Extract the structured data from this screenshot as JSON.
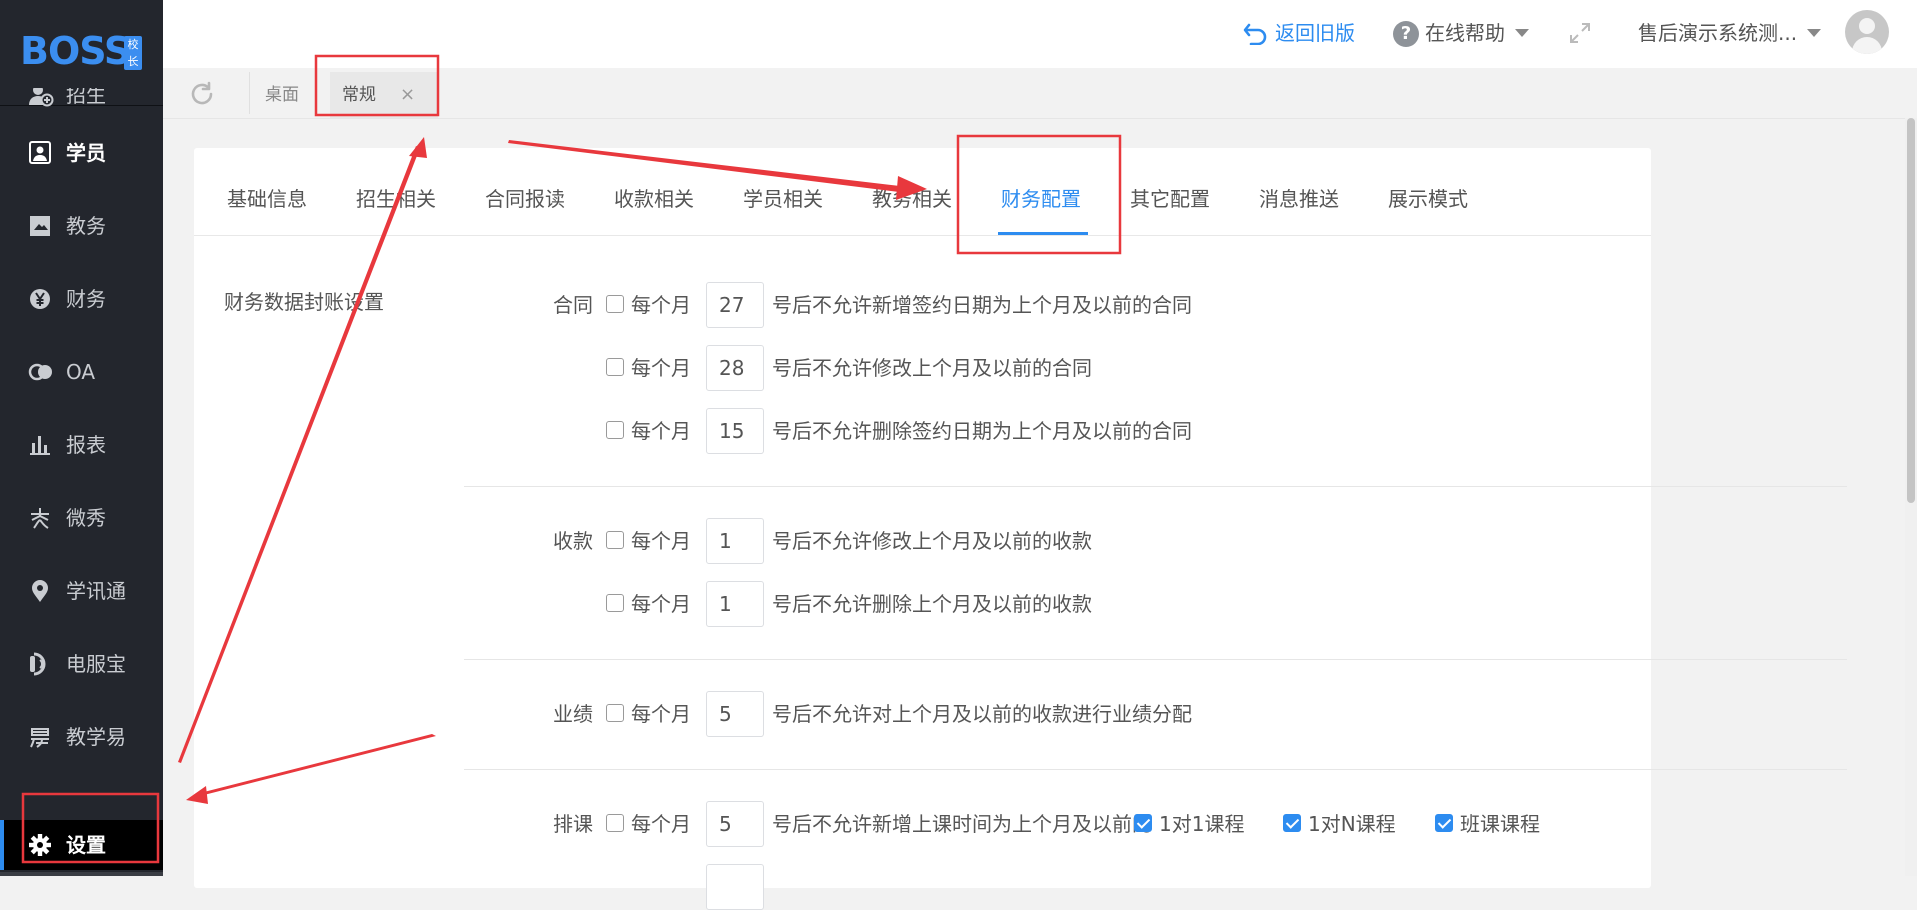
{
  "logo": {
    "text": "BOSS",
    "badge": "校长"
  },
  "sidebar": {
    "items": [
      {
        "label": "招生",
        "icon": "enroll-icon"
      },
      {
        "label": "学员",
        "icon": "student-icon"
      },
      {
        "label": "教务",
        "icon": "book-icon"
      },
      {
        "label": "财务",
        "icon": "yen-icon"
      },
      {
        "label": "OA",
        "icon": "oa-icon"
      },
      {
        "label": "报表",
        "icon": "bar-chart-icon"
      },
      {
        "label": "微秀",
        "icon": "weixiu-icon"
      },
      {
        "label": "学讯通",
        "icon": "location-pin-icon"
      },
      {
        "label": "电服宝",
        "icon": "phone-icon"
      },
      {
        "label": "教学易",
        "icon": "jiaoxueyi-icon"
      },
      {
        "label": "设置",
        "icon": "gear-icon"
      }
    ]
  },
  "header": {
    "back_old": "返回旧版",
    "help": "在线帮助",
    "user": "售后演示系统测..."
  },
  "tabs": [
    {
      "label": "桌面"
    },
    {
      "label": "常规",
      "close": "×"
    }
  ],
  "subtabs": [
    {
      "label": "基础信息"
    },
    {
      "label": "招生相关"
    },
    {
      "label": "合同报读"
    },
    {
      "label": "收款相关"
    },
    {
      "label": "学员相关"
    },
    {
      "label": "教务相关"
    },
    {
      "label": "财务配置",
      "active": true
    },
    {
      "label": "其它配置"
    },
    {
      "label": "消息推送"
    },
    {
      "label": "展示模式"
    }
  ],
  "finance": {
    "section_title": "财务数据封账设置",
    "every_month": "每个月",
    "contract": {
      "label": "合同",
      "rows": [
        {
          "checked": false,
          "value": "27",
          "desc": "号后不允许新增签约日期为上个月及以前的合同"
        },
        {
          "checked": false,
          "value": "28",
          "desc": "号后不允许修改上个月及以前的合同"
        },
        {
          "checked": false,
          "value": "15",
          "desc": "号后不允许删除签约日期为上个月及以前的合同"
        }
      ]
    },
    "payment": {
      "label": "收款",
      "rows": [
        {
          "checked": false,
          "value": "1",
          "desc": "号后不允许修改上个月及以前的收款"
        },
        {
          "checked": false,
          "value": "1",
          "desc": "号后不允许删除上个月及以前的收款"
        }
      ]
    },
    "performance": {
      "label": "业绩",
      "rows": [
        {
          "checked": false,
          "value": "5",
          "desc": "号后不允许对上个月及以前的收款进行业绩分配"
        }
      ]
    },
    "schedule": {
      "label": "排课",
      "rows": [
        {
          "checked": false,
          "value": "5",
          "desc": "号后不允许新增上课时间为上个月及以前的"
        }
      ],
      "options": [
        {
          "label": "1对1课程",
          "checked": true
        },
        {
          "label": "1对N课程",
          "checked": true
        },
        {
          "label": "班课课程",
          "checked": true
        }
      ]
    }
  },
  "colors": {
    "accent": "#2d8cf0",
    "sidebar_bg": "#23262d",
    "annotation": "#e8383d"
  }
}
